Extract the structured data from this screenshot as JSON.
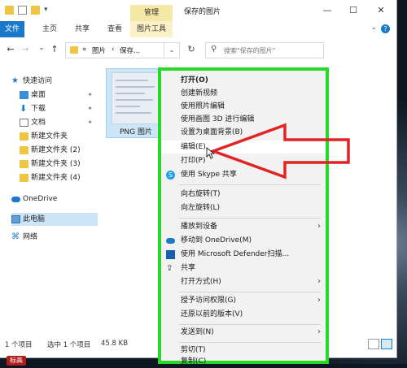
{
  "titlebar": {
    "context_tab_head": "管理",
    "title": "保存的图片",
    "min": "—",
    "max": "☐",
    "close": "✕"
  },
  "ribbon": {
    "tabs": [
      "文件",
      "主页",
      "共享",
      "查看",
      "图片工具"
    ],
    "help": "?",
    "collapse": "⌄"
  },
  "address": {
    "back": "←",
    "forward": "→",
    "recent": "⌄",
    "up": "↑",
    "segments": [
      "«",
      "图片",
      "›",
      "保存..."
    ],
    "dropdown": "⌄",
    "refresh": "↻",
    "search_placeholder": "搜索\"保存的图片\""
  },
  "navpane": {
    "quick_access": "快速访问",
    "items": [
      {
        "label": "桌面",
        "pin": "📌"
      },
      {
        "label": "下载",
        "pin": "📌"
      },
      {
        "label": "文档",
        "pin": "📌"
      },
      {
        "label": "新建文件夹"
      },
      {
        "label": "新建文件夹 (2)"
      },
      {
        "label": "新建文件夹 (3)"
      },
      {
        "label": "新建文件夹 (4)"
      }
    ],
    "onedrive": "OneDrive",
    "this_pc": "此电脑",
    "network": "网络"
  },
  "content": {
    "file_caption": "PNG 图片"
  },
  "statusbar": {
    "count": "1 个项目",
    "selected": "选中 1 个项目",
    "size": "45.8 KB"
  },
  "watermark": "标高",
  "context_menu": {
    "items": [
      {
        "label": "打开(O)"
      },
      {
        "label": "创建新视频"
      },
      {
        "label": "使用照片编辑"
      },
      {
        "label": "使用画图 3D 进行编辑"
      },
      {
        "label": "设置为桌面背景(B)"
      },
      {
        "label": "编辑(E)"
      },
      {
        "label": "打印(P)"
      },
      {
        "label": "使用 Skype 共享"
      },
      {
        "label": "向右旋转(T)"
      },
      {
        "label": "向左旋转(L)"
      },
      {
        "label": "播放到设备",
        "submenu": "›"
      },
      {
        "label": "移动到 OneDrive(M)"
      },
      {
        "label": "使用 Microsoft Defender扫描..."
      },
      {
        "label": "共享"
      },
      {
        "label": "打开方式(H)",
        "submenu": "›"
      },
      {
        "label": "授予访问权限(G)",
        "submenu": "›"
      },
      {
        "label": "还原以前的版本(V)"
      },
      {
        "label": "发送到(N)",
        "submenu": "›"
      },
      {
        "label": "剪切(T)"
      },
      {
        "label": "复制(C)"
      }
    ]
  },
  "colors": {
    "menu_border": "#26d926",
    "arrow": "#e02424",
    "file_tab": "#1979ca",
    "context_tab": "#f5e7a6"
  }
}
